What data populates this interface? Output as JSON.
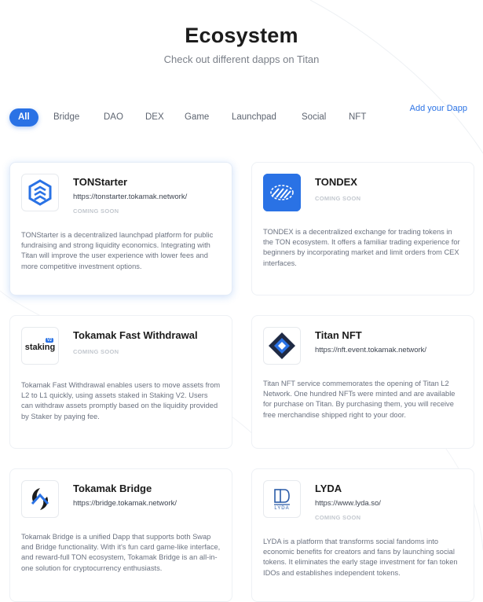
{
  "header": {
    "title": "Ecosystem",
    "subtitle": "Check out different dapps on Titan"
  },
  "filters": [
    "All",
    "Bridge",
    "DAO",
    "DEX",
    "Game",
    "Launchpad",
    "Social",
    "NFT"
  ],
  "add_dapp_label": "Add your Dapp",
  "colors": {
    "accent": "#2a72e5"
  },
  "cards": [
    {
      "title": "TONStarter",
      "url": "https://tonstarter.tokamak.network/",
      "status": "COMING SOON",
      "description": "TONStarter is a decentralized launchpad platform for public fundraising and strong liquidity economics. Integrating with Titan will improve the user experience with lower fees and more competitive investment options.",
      "icon": "tonstarter-logo-icon"
    },
    {
      "title": "TONDEX",
      "url": "",
      "status": "COMING SOON",
      "description": "TONDEX is a decentralized exchange for trading tokens in the TON ecosystem. It offers a familiar trading experience for beginners by incorporating market and limit orders from CEX interfaces.",
      "icon": "tondex-logo-icon"
    },
    {
      "title": "Tokamak Fast Withdrawal",
      "url": "",
      "status": "COMING SOON",
      "description": "Tokamak Fast Withdrawal enables users to move assets from L2 to L1 quickly, using assets staked in Staking V2. Users can withdraw assets promptly based on the liquidity provided by Staker by paying fee.",
      "icon": "staking-logo-icon",
      "logo_text": "staking",
      "logo_badge": "V2"
    },
    {
      "title": "Titan NFT",
      "url": "https://nft.event.tokamak.network/",
      "status": "",
      "description": "Titan NFT service commemorates the opening of Titan L2 Network. One hundred NFTs were minted and are available for purchase on Titan. By purchasing them, you will receive free merchandise shipped right to your door.",
      "icon": "titan-nft-logo-icon"
    },
    {
      "title": "Tokamak Bridge",
      "url": "https://bridge.tokamak.network/",
      "status": "",
      "description": "Tokamak Bridge is a unified Dapp that supports both Swap and Bridge functionality. With it's fun card game-like interface, and reward-full TON ecosystem, Tokamak Bridge is an all-in-one solution for cryptocurrency enthusiasts.",
      "icon": "tokamak-bridge-logo-icon"
    },
    {
      "title": "LYDA",
      "url": "https://www.lyda.so/",
      "status": "COMING SOON",
      "description": "LYDA is a platform that transforms social fandoms into economic benefits for creators and fans by launching social tokens. It eliminates the early stage investment for fan token IDOs and establishes independent tokens.",
      "icon": "lyda-logo-icon",
      "logo_text": "LYDA"
    }
  ]
}
